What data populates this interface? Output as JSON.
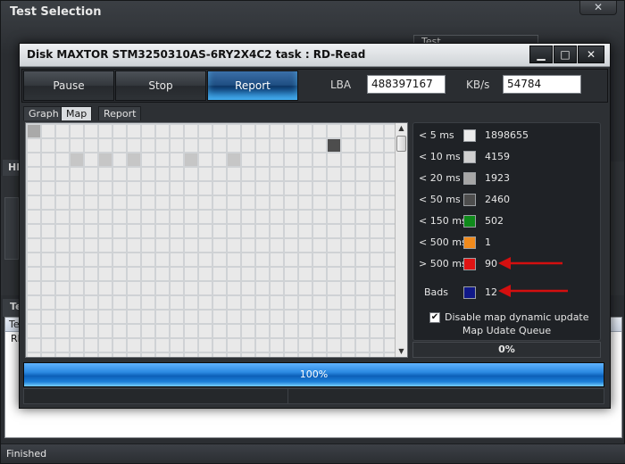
{
  "background": {
    "title": "Test Selection",
    "close_glyph": "✕",
    "test_label": "Test",
    "hd_label": "HD",
    "te_label": "Te",
    "list_header": "Te",
    "list_row": "RD",
    "status": "Finished"
  },
  "dialog": {
    "title": "Disk MAXTOR STM3250310AS-6RY2X4C2   task : RD-Read",
    "buttons": {
      "minimize": "▁",
      "maximize": "□",
      "close": "✕"
    }
  },
  "toolbar": {
    "pause": "Pause",
    "stop": "Stop",
    "report": "Report",
    "lba_label": "LBA",
    "lba_value": "488397167",
    "speed_label": "KB/s",
    "speed_value": "54784"
  },
  "tabs": [
    "Graph",
    "Map",
    "Report"
  ],
  "legend": {
    "rows": [
      {
        "label": "< 5 ms",
        "color": "#ececec",
        "count": "1898655"
      },
      {
        "label": "< 10 ms",
        "color": "#d0d0d0",
        "count": "4159"
      },
      {
        "label": "< 20 ms",
        "color": "#a6a6a6",
        "count": "1923"
      },
      {
        "label": "< 50 ms",
        "color": "#4d4d4d",
        "count": "2460"
      },
      {
        "label": "< 150 ms",
        "color": "#0f8a1b",
        "count": "502"
      },
      {
        "label": "< 500 ms",
        "color": "#f08a1c",
        "count": "1"
      },
      {
        "label": "> 500 ms",
        "color": "#e01414",
        "count": "90"
      },
      {
        "label": "Bads",
        "color": "#101888",
        "count": "12"
      }
    ],
    "checkbox_label": "Disable map dynamic update",
    "checkbox_checked": "✔",
    "queue_label": "Map Udate Queue",
    "queue_value": "0%"
  },
  "progress": {
    "label": "100%",
    "percent": 100
  },
  "colors": {
    "accent": "#2a88e0",
    "arrow": "#d40f0f"
  }
}
